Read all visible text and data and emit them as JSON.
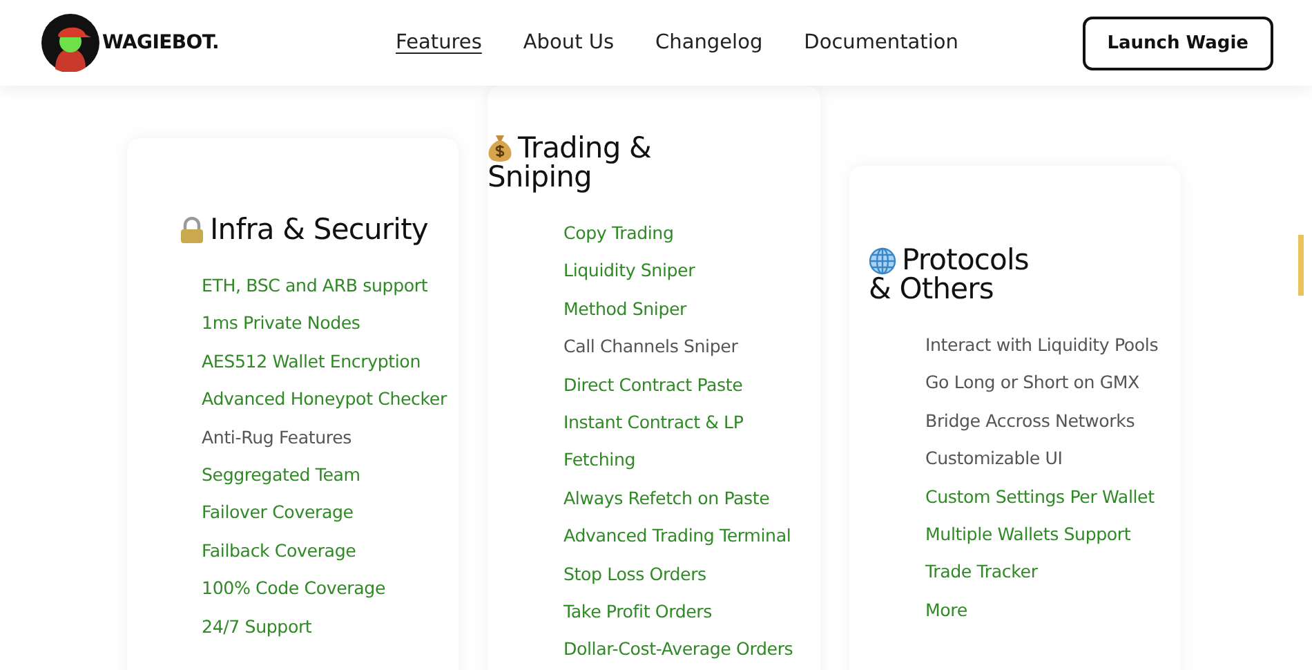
{
  "header": {
    "brand": "WAGIEBOT.",
    "nav": [
      {
        "label": "Features",
        "selected": true
      },
      {
        "label": "About Us",
        "selected": false
      },
      {
        "label": "Changelog",
        "selected": false
      },
      {
        "label": "Documentation",
        "selected": false
      }
    ],
    "button": "Launch Wagie"
  },
  "cards": [
    {
      "title": [
        "Infra & Security"
      ],
      "items": [
        {
          "label": "ETH, BSC and ARB support",
          "ready": true
        },
        {
          "label": "1ms Private Nodes",
          "ready": true
        },
        {
          "label": "AES512 Wallet Encryption",
          "ready": true
        },
        {
          "label": "Advanced Honeypot Checker",
          "ready": true
        },
        {
          "label": "Anti-Rug Features",
          "ready": false
        },
        {
          "label": "Seggregated Team",
          "ready": true
        },
        {
          "label": "Failover Coverage",
          "ready": true
        },
        {
          "label": "Failback Coverage",
          "ready": true
        },
        {
          "label": "100% Code Coverage",
          "ready": true
        },
        {
          "label": "24/7 Support",
          "ready": true
        }
      ]
    },
    {
      "title": [
        "Trading &",
        "Sniping"
      ],
      "items": [
        {
          "label": "Copy Trading",
          "ready": true
        },
        {
          "label": "Liquidity Sniper",
          "ready": true
        },
        {
          "label": "Method Sniper",
          "ready": true
        },
        {
          "label": "Call Channels Sniper",
          "ready": false
        },
        {
          "label": "Direct Contract Paste",
          "ready": true
        },
        {
          "label": "Instant Contract & LP",
          "ready": true
        },
        {
          "label": "Fetching",
          "ready": true
        },
        {
          "label": "Always Refetch on Paste",
          "ready": true
        },
        {
          "label": "Advanced Trading Terminal",
          "ready": true
        },
        {
          "label": "Stop Loss Orders",
          "ready": true
        },
        {
          "label": "Take Profit Orders",
          "ready": true
        },
        {
          "label": "Dollar-Cost-Average Orders",
          "ready": true
        }
      ]
    },
    {
      "title": [
        "Protocols",
        "& Others"
      ],
      "items": [
        {
          "label": "Interact with Liquidity Pools",
          "ready": false
        },
        {
          "label": "Go Long or Short on GMX",
          "ready": false
        },
        {
          "label": "Bridge Accross Networks",
          "ready": false
        },
        {
          "label": "Customizable UI",
          "ready": false
        },
        {
          "label": "Custom Settings Per Wallet",
          "ready": true
        },
        {
          "label": "Multiple Wallets Support",
          "ready": true
        },
        {
          "label": "Trade Tracker",
          "ready": true
        },
        {
          "label": "More",
          "ready": true
        }
      ]
    }
  ]
}
